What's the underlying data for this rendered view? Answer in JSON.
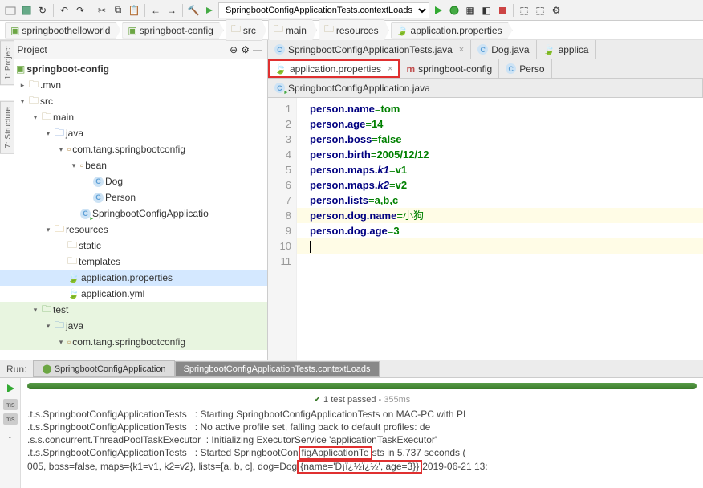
{
  "run_config": "SpringbootConfigApplicationTests.contextLoads",
  "breadcrumb": [
    {
      "icon": "module",
      "label": "springboothelloworld"
    },
    {
      "icon": "module",
      "label": "springboot-config"
    },
    {
      "icon": "folder",
      "label": "src"
    },
    {
      "icon": "folder",
      "label": "main"
    },
    {
      "icon": "folder",
      "label": "resources"
    },
    {
      "icon": "props",
      "label": "application.properties"
    }
  ],
  "project_header": "Project",
  "tree": [
    {
      "d": 0,
      "a": "v",
      "i": "module",
      "t": "springboot-config",
      "bold": true
    },
    {
      "d": 1,
      "a": ">",
      "i": "folder",
      "t": ".mvn"
    },
    {
      "d": 1,
      "a": "v",
      "i": "folder",
      "t": "src"
    },
    {
      "d": 2,
      "a": "v",
      "i": "folder",
      "t": "main"
    },
    {
      "d": 3,
      "a": "v",
      "i": "folder-src",
      "t": "java"
    },
    {
      "d": 4,
      "a": "v",
      "i": "pkg",
      "t": "com.tang.springbootconfig"
    },
    {
      "d": 5,
      "a": "v",
      "i": "pkg",
      "t": "bean"
    },
    {
      "d": 6,
      "a": "",
      "i": "class",
      "t": "Dog"
    },
    {
      "d": 6,
      "a": "",
      "i": "class",
      "t": "Person"
    },
    {
      "d": 5,
      "a": "",
      "i": "class-s",
      "t": "SpringbootConfigApplicatio"
    },
    {
      "d": 3,
      "a": "v",
      "i": "folder-res",
      "t": "resources"
    },
    {
      "d": 4,
      "a": "",
      "i": "folder",
      "t": "static"
    },
    {
      "d": 4,
      "a": "",
      "i": "folder",
      "t": "templates"
    },
    {
      "d": 4,
      "a": "",
      "i": "props",
      "t": "application.properties",
      "sel": true
    },
    {
      "d": 4,
      "a": "",
      "i": "props",
      "t": "application.yml"
    },
    {
      "d": 2,
      "a": "v",
      "i": "folder-test",
      "t": "test",
      "bg": "#e8f5e0"
    },
    {
      "d": 3,
      "a": "v",
      "i": "folder-src",
      "t": "java",
      "bg": "#e8f5e0"
    },
    {
      "d": 4,
      "a": "v",
      "i": "pkg",
      "t": "com.tang.springbootconfig",
      "bg": "#e8f5e0"
    }
  ],
  "tabs_row1": [
    {
      "icon": "class",
      "label": "SpringbootConfigApplicationTests.java",
      "close": true
    },
    {
      "icon": "class",
      "label": "Dog.java"
    },
    {
      "icon": "props",
      "label": "applica"
    }
  ],
  "tabs_row2": [
    {
      "icon": "props",
      "label": "application.properties",
      "active": true,
      "hl": true,
      "close": true
    },
    {
      "icon": "maven",
      "label": "springboot-config"
    },
    {
      "icon": "class",
      "label": "Perso"
    }
  ],
  "tabs_row3": [
    {
      "icon": "class-s",
      "label": "SpringbootConfigApplication.java",
      "full": true
    }
  ],
  "chart_data": {
    "type": "table",
    "title": "application.properties",
    "rows": [
      {
        "key": "person.name",
        "value": "tom"
      },
      {
        "key": "person.age",
        "value": "14"
      },
      {
        "key": "person.boss",
        "value": "false"
      },
      {
        "key": "person.birth",
        "value": "2005/12/12"
      },
      {
        "key": "person.maps.k1",
        "value": "v1",
        "italic_key_suffix": "k1"
      },
      {
        "key": "person.maps.k2",
        "value": "v2",
        "italic_key_suffix": "k2"
      },
      {
        "key": "person.lists",
        "value": "a,b,c"
      },
      {
        "key": "person.dog.name",
        "value": "小狗"
      },
      {
        "key": "person.dog.age",
        "value": "3"
      }
    ]
  },
  "run": {
    "label": "Run:",
    "tab1": "SpringbootConfigApplication",
    "tab2": "SpringbootConfigApplicationTests.contextLoads",
    "status": "1 test passed",
    "status_time": "355ms",
    "console": [
      ".t.s.SpringbootConfigApplicationTests   : Starting SpringbootConfigApplicationTests on MAC-PC with PI",
      ".t.s.SpringbootConfigApplicationTests   : No active profile set, falling back to default profiles: de",
      ".s.s.concurrent.ThreadPoolTaskExecutor  : Initializing ExecutorService 'applicationTaskExecutor'",
      ".t.s.SpringbootConfigApplicationTests   : Started SpringbootConfigApplicationTests in 5.737 seconds (",
      "005, boss=false, maps={k1=v1, k2=v2}, lists=[a, b, c], dog=Dog{name='Ð¡ï¿½ï¿½', age=3}}2019-06-21 13:"
    ],
    "hl_fragment": "{name='Ð¡ï¿½ï¿½', age=3}}"
  }
}
